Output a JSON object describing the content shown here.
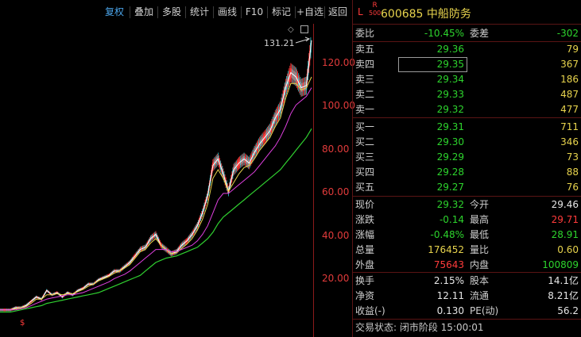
{
  "toolbar": {
    "buttons": [
      "复权",
      "叠加",
      "多股",
      "统计",
      "画线",
      "F10",
      "标记",
      "+自选",
      "返回"
    ]
  },
  "chart": {
    "high_label": "131.21",
    "yticks": [
      "120.00",
      "100.00",
      "80.00",
      "60.00",
      "40.00",
      "20.00"
    ]
  },
  "chart_data": {
    "type": "line",
    "title": "",
    "xlabel": "",
    "ylabel": "",
    "ylim": [
      0,
      140
    ],
    "series": [
      {
        "values": [
          5,
          5,
          5,
          6,
          6,
          7,
          9,
          11,
          10,
          14,
          12,
          13,
          11,
          13,
          12,
          14,
          15,
          17,
          17,
          19,
          20,
          21,
          23,
          23,
          25,
          27,
          30,
          33,
          34,
          38,
          40,
          35,
          33,
          31,
          32,
          35,
          37,
          40,
          44,
          50,
          58,
          72,
          75,
          68,
          60,
          70,
          73,
          75,
          73,
          78,
          82,
          85,
          88,
          94,
          98,
          108,
          115,
          113,
          108,
          109,
          130
        ]
      },
      {
        "values": [
          5,
          5,
          5,
          5.5,
          6,
          6.5,
          8,
          10,
          10,
          12,
          12,
          12.5,
          12,
          12.5,
          12.5,
          13.5,
          14.5,
          16,
          17,
          18.5,
          19.5,
          20.5,
          22,
          23,
          24.5,
          26,
          29,
          32,
          33,
          36,
          38,
          35,
          33,
          31,
          31.5,
          33.5,
          35.5,
          38,
          42,
          47,
          54,
          66,
          70,
          66,
          60,
          64,
          68,
          71,
          72,
          75,
          79,
          82,
          85,
          90,
          94,
          103,
          110,
          110,
          107,
          108,
          113
        ]
      },
      {
        "values": [
          5,
          5,
          5,
          5,
          5.5,
          6,
          7,
          8,
          9,
          10,
          10.5,
          11,
          11.5,
          12,
          12,
          12.5,
          13,
          14,
          15,
          16,
          17,
          18,
          19.5,
          20.5,
          21.5,
          23,
          25,
          27,
          29,
          31,
          33,
          33,
          33,
          32,
          32,
          33,
          34,
          35,
          37,
          40,
          44,
          50,
          56,
          59,
          59,
          61,
          63,
          65,
          67,
          69,
          72,
          75,
          78,
          81,
          85,
          90,
          96,
          100,
          102,
          104,
          108
        ]
      },
      {
        "values": [
          4,
          4,
          4,
          4.5,
          5,
          5.5,
          6,
          6.5,
          7,
          8,
          8.5,
          9,
          9.5,
          10,
          10.5,
          11,
          11.5,
          12,
          12.5,
          13,
          14,
          15,
          16,
          17,
          18,
          19,
          20,
          21,
          23,
          25,
          27,
          28,
          29,
          29.5,
          30,
          31,
          32,
          33,
          34,
          36,
          38,
          41,
          45,
          48,
          50,
          52,
          54,
          56,
          58,
          60,
          62,
          64,
          66,
          68,
          70,
          73,
          76,
          79,
          82,
          85,
          89
        ]
      }
    ]
  },
  "quote": {
    "L": "L",
    "R": "R",
    "R_sub": "500",
    "title": "600685 中船防务",
    "webi_label": "委比",
    "webi_value": "-10.45%",
    "wecha_label": "委差",
    "wecha_value": "-302",
    "asks": [
      {
        "label": "卖五",
        "price": "29.36",
        "vol": "79"
      },
      {
        "label": "卖四",
        "price": "29.35",
        "vol": "367"
      },
      {
        "label": "卖三",
        "price": "29.34",
        "vol": "186"
      },
      {
        "label": "卖二",
        "price": "29.33",
        "vol": "487"
      },
      {
        "label": "卖一",
        "price": "29.32",
        "vol": "477"
      }
    ],
    "bids": [
      {
        "label": "买一",
        "price": "29.31",
        "vol": "711"
      },
      {
        "label": "买二",
        "price": "29.30",
        "vol": "346"
      },
      {
        "label": "买三",
        "price": "29.29",
        "vol": "73"
      },
      {
        "label": "买四",
        "price": "29.28",
        "vol": "88"
      },
      {
        "label": "买五",
        "price": "29.27",
        "vol": "76"
      }
    ],
    "stats1": [
      {
        "l1": "现价",
        "v1": "29.32",
        "c1": "green",
        "l2": "今开",
        "v2": "29.46",
        "c2": "white"
      },
      {
        "l1": "涨跌",
        "v1": "-0.14",
        "c1": "green",
        "l2": "最高",
        "v2": "29.71",
        "c2": "red"
      },
      {
        "l1": "涨幅",
        "v1": "-0.48%",
        "c1": "green",
        "l2": "最低",
        "v2": "28.91",
        "c2": "green"
      },
      {
        "l1": "总量",
        "v1": "176452",
        "c1": "yellow",
        "l2": "量比",
        "v2": "0.60",
        "c2": "yellow"
      },
      {
        "l1": "外盘",
        "v1": "75643",
        "c1": "red",
        "l2": "内盘",
        "v2": "100809",
        "c2": "green"
      }
    ],
    "stats2": [
      {
        "l1": "换手",
        "v1": "2.15%",
        "l2": "股本",
        "v2": "14.1亿"
      },
      {
        "l1": "净资",
        "v1": "12.11",
        "l2": "流通",
        "v2": "8.21亿"
      },
      {
        "l1": "收益(-)",
        "v1": "0.130",
        "l2": "PE(动)",
        "v2": "56.2"
      }
    ],
    "status": "交易状态: 闭市阶段 15:00:01"
  },
  "colors": {
    "up": "#ff3b3b",
    "down": "#2dd42d",
    "volume": "#e8d44d",
    "ma_white": "#ffffff",
    "ma_yellow": "#e8d44d",
    "ma_magenta": "#e040e0",
    "ma_green": "#30d030"
  }
}
